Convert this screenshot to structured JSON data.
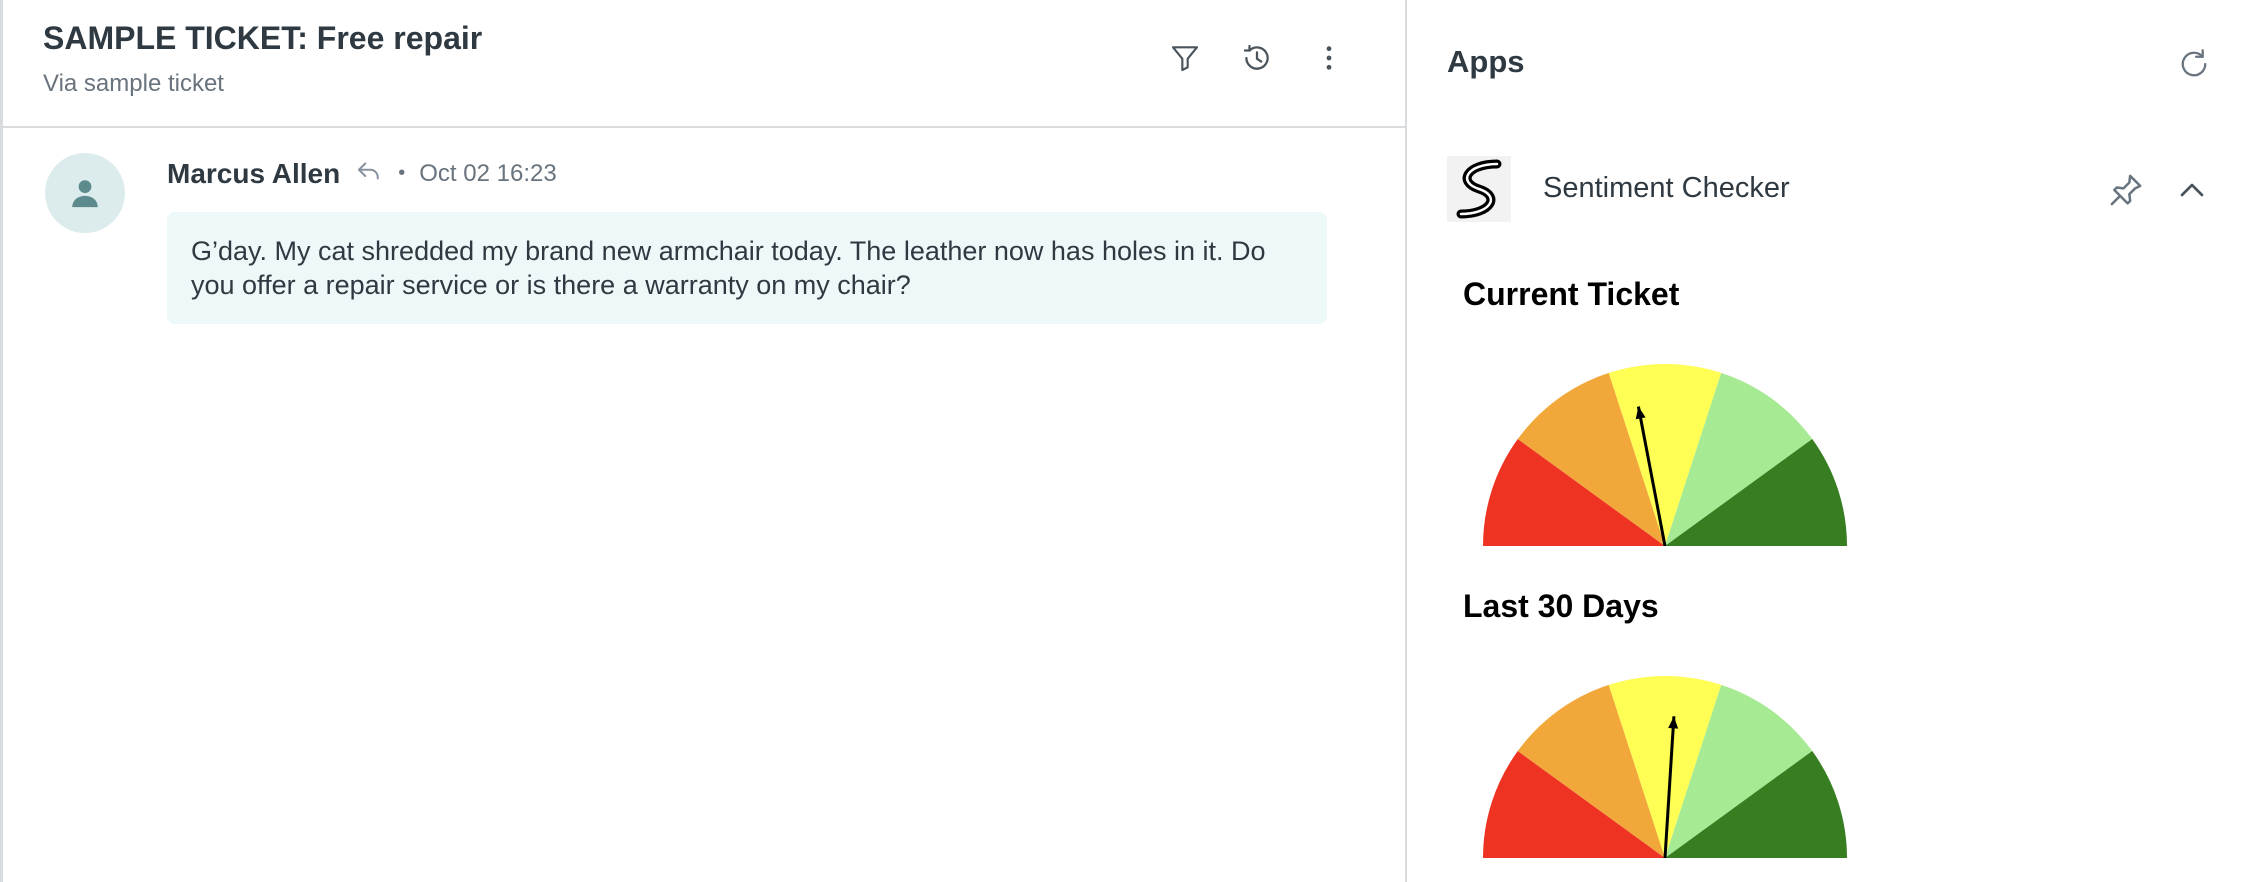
{
  "ticket": {
    "title": "SAMPLE TICKET: Free repair",
    "subtitle": "Via sample ticket"
  },
  "header_icons": [
    "filter-icon",
    "history-icon",
    "more-options-icon"
  ],
  "message": {
    "author": "Marcus Allen",
    "separator": "•",
    "timestamp": "Oct 02 16:23",
    "body": "G’day. My cat shredded my brand new armchair today. The leather now has holes in it. Do you offer a repair service or is there a warranty on my chair?"
  },
  "apps": {
    "title": "Apps",
    "app_name": "Sentiment Checker"
  },
  "gauges": {
    "current": {
      "label": "Current Ticket",
      "needle_fraction": 0.44
    },
    "last30": {
      "label": "Last 30 Days",
      "needle_fraction": 0.52
    },
    "segment_colors": [
      "#ef3323",
      "#f2a73b",
      "#fefe54",
      "#a6ea94",
      "#377e21"
    ]
  },
  "colors": {
    "accent_bg": "#edf8f9",
    "avatar_bg": "#dcecec",
    "avatar_fg": "#5d8a8c"
  }
}
